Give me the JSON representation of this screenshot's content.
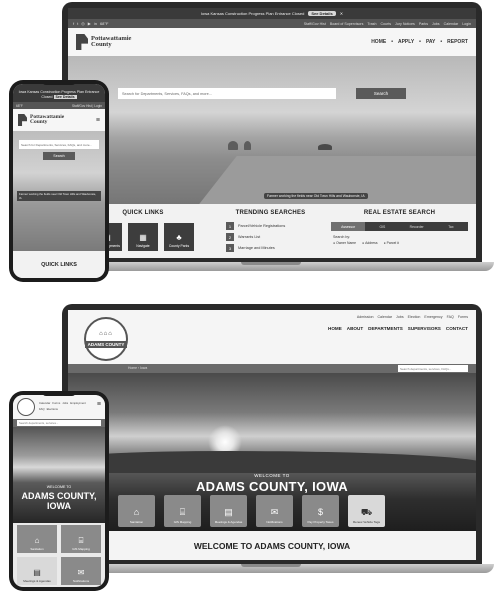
{
  "pottawattamie": {
    "alert_text": "Iowa Kansas Construction Progress Plan Entrance Closed",
    "alert_button": "See Details",
    "social_icons": [
      "f",
      "t",
      "◎",
      "▶",
      "in"
    ],
    "temperature": "68°F",
    "utility_links": [
      "Staff/Gov Hist",
      "Board of Supervisors",
      "Trash",
      "Courts",
      "Jury Notices",
      "Parks",
      "Jobs",
      "Calendar",
      "Login"
    ],
    "logo_name": "Pottawattamie",
    "logo_sub": "County",
    "nav": [
      "HOME",
      "APPLY",
      "PAY",
      "REPORT"
    ],
    "search_placeholder": "Search for Departments, Services, FAQs, and more...",
    "search_button": "Search",
    "hero_caption": "Farmer working the fields near Old Town Hills and Waubonsie, IA",
    "quick_links_title": "QUICK LINKS",
    "quick_links": [
      {
        "icon": "▤",
        "label": "Online Payments"
      },
      {
        "icon": "▦",
        "label": "Navigate"
      },
      {
        "icon": "♣",
        "label": "County Parks"
      }
    ],
    "trending_title": "TRENDING SEARCHES",
    "trending": [
      {
        "num": "1",
        "label": "Parcel/Vehicle Registrations"
      },
      {
        "num": "2",
        "label": "Warrants List"
      },
      {
        "num": "3",
        "label": "Marriage and Minutes"
      }
    ],
    "real_estate_title": "REAL ESTATE SEARCH",
    "real_estate_tabs": [
      "Assessor",
      "GIS",
      "Recorder",
      "Tax"
    ],
    "real_estate_search_by": "Search by:",
    "real_estate_options": [
      "Owner Name",
      "Address",
      "Parcel #"
    ]
  },
  "pottawattamie_mobile": {
    "alert_text": "Iowa Kansas Construction Progress Plan Entrance Closed",
    "alert_button": "See Details",
    "temperature": "68°F",
    "util_right": "Staff/Gov Hist  |  Login",
    "logo_name": "Pottawattamie",
    "logo_sub": "County",
    "menu_icon": "≡",
    "search_placeholder": "Search for Departments, Services, FAQs, and more...",
    "search_button": "Search",
    "hero_caption": "Farmer working the fields near Old Town Hills and Waubonsie, IA",
    "quick_links_title": "QUICK LINKS"
  },
  "adams": {
    "seal_text": "ADAMS COUNTY",
    "seal_icons": "⌂⌂⌂",
    "utility_links": [
      "Admission",
      "Calendar",
      "Jobs",
      "Election",
      "Emergency",
      "FAQ",
      "Forms"
    ],
    "nav": [
      "HOME",
      "ABOUT",
      "DEPARTMENTS",
      "SUPERVISORS",
      "CONTACT"
    ],
    "breadcrumb": "Home  ›  Iowa",
    "search_placeholder": "Search departments, services, FAQs...",
    "welcome_small": "WELCOME TO",
    "welcome_big": "ADAMS COUNTY, IOWA",
    "tiles": [
      {
        "icon": "⌂",
        "label": "Sanitation",
        "light": false
      },
      {
        "icon": "⌸",
        "label": "GIS Mapping",
        "light": false
      },
      {
        "icon": "▤",
        "label": "Meetings & Agendas",
        "light": false
      },
      {
        "icon": "✉",
        "label": "Notifications",
        "light": false
      },
      {
        "icon": "$",
        "label": "Pay Property Taxes",
        "light": false
      },
      {
        "icon": "⛟",
        "label": "Renew Vehicle Tags",
        "light": true
      }
    ],
    "footer_heading": "WELCOME TO ADAMS COUNTY, IOWA"
  },
  "adams_mobile": {
    "links": [
      "Calendar",
      "Forms",
      "Jobs",
      "Employment",
      "FAQ",
      "Elections"
    ],
    "menu_icon": "≡",
    "search_placeholder": "Search departments, services...",
    "welcome_small": "WELCOME TO",
    "welcome_big_line1": "ADAMS COUNTY,",
    "welcome_big_line2": "IOWA",
    "tiles": [
      {
        "icon": "⌂",
        "label": "Sanitation",
        "light": false
      },
      {
        "icon": "⌸",
        "label": "GIS Mapping",
        "light": false
      },
      {
        "icon": "▤",
        "label": "Meetings & Agendas",
        "light": true
      },
      {
        "icon": "✉",
        "label": "Notifications",
        "light": false
      }
    ]
  }
}
